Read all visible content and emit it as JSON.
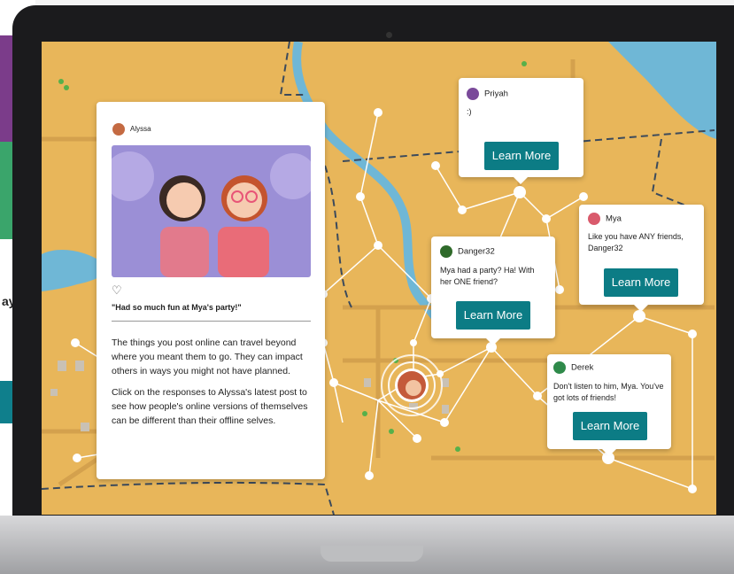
{
  "background": {
    "fragment_text": "ay"
  },
  "post": {
    "author": "Alyssa",
    "caption": "\"Had so much fun at Mya's party!\"",
    "paragraph1": "The things you post online can travel beyond where you meant them to go. They can impact others in ways you might not have planned.",
    "paragraph2": "Click on the responses to Alyssa's latest post to see how people's online versions of themselves can be different than their offline selves."
  },
  "responses": [
    {
      "name": "Priyah",
      "message": ":)",
      "button": "Learn More"
    },
    {
      "name": "Danger32",
      "message": "Mya had a party? Ha! With her ONE friend?",
      "button": "Learn More"
    },
    {
      "name": "Mya",
      "message": "Like you have ANY friends, Danger32",
      "button": "Learn More"
    },
    {
      "name": "Derek",
      "message": "Don't listen to him, Mya. You've got lots of friends!",
      "button": "Learn More"
    }
  ],
  "colors": {
    "map": "#e8b65a",
    "water": "#6fb7d6",
    "road": "#d9a44c",
    "button": "#0c7c85"
  },
  "icons": {
    "like": "heart-outline-icon",
    "center": "avatar-pin-icon"
  }
}
